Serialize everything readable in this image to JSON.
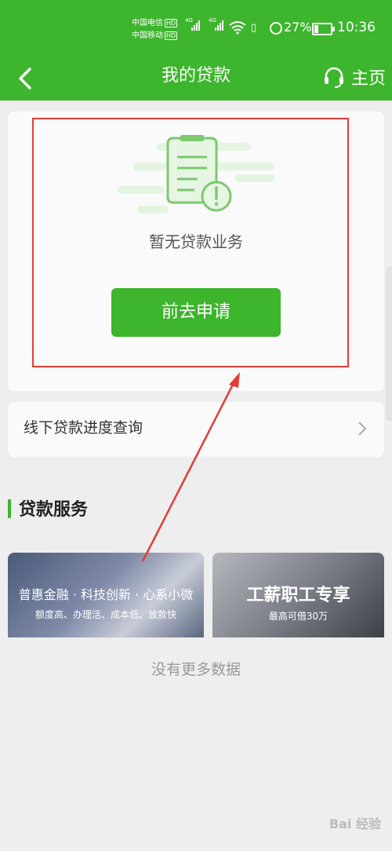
{
  "status": {
    "carrier1": "中国电信",
    "carrier2": "中国移动",
    "hd": "HD",
    "net1": "4G",
    "net2": "4G",
    "battery": "27%",
    "battery_level": 0.27,
    "time": "10:36"
  },
  "nav": {
    "title": "我的贷款",
    "home_label": "主页"
  },
  "empty": {
    "message": "暂无贷款业务",
    "apply_button": "前去申请"
  },
  "offline": {
    "label": "线下贷款进度查询"
  },
  "services": {
    "title": "贷款服务",
    "items": [
      {
        "title": "普惠金融 · 科技创新 · 心系小微",
        "subtitle": "额度高、办理活、成本低、放款快"
      },
      {
        "title": "工薪职工专享",
        "subtitle": "最高可借30万"
      }
    ]
  },
  "footer": {
    "no_more": "没有更多数据"
  },
  "watermark": "Bai 经验",
  "colors": {
    "accent": "#3db52d",
    "annotation": "#e53b35"
  }
}
